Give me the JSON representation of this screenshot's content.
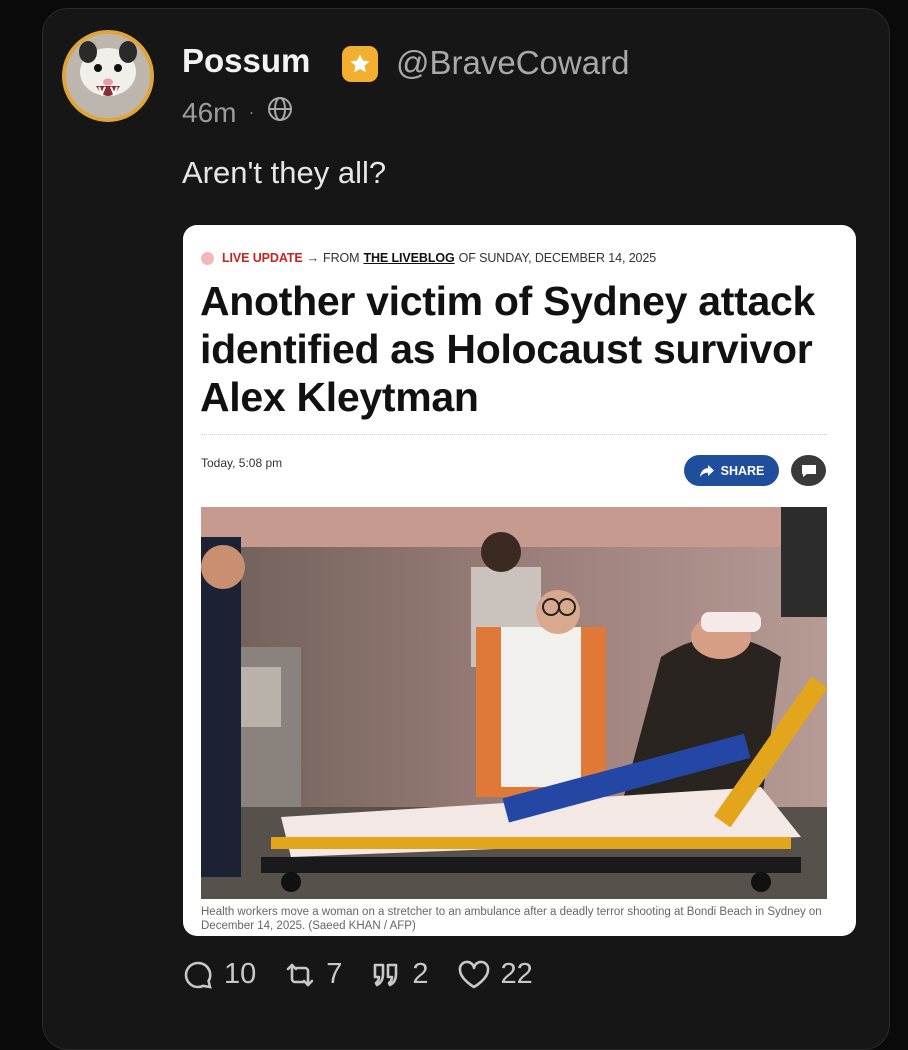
{
  "post": {
    "display_name": "Possum",
    "handle": "@BraveCoward",
    "time_ago": "46m",
    "separator": "·",
    "text": "Aren't they all?"
  },
  "article": {
    "live_label": "LIVE UPDATE",
    "arrow": "→",
    "from_text": "FROM",
    "liveblog_text": "THE LIVEBLOG",
    "date_text": "OF SUNDAY, DECEMBER 14, 2025",
    "headline": "Another victim of Sydney attack identified as Holocaust survivor Alex Kleytman",
    "time": "Today, 5:08 pm",
    "share_label": "SHARE",
    "caption": "Health workers move a woman on a stretcher to an ambulance after a deadly terror shooting at Bondi Beach in Sydney on December 14, 2025. (Saeed KHAN / AFP)"
  },
  "actions": {
    "replies": "10",
    "reposts": "7",
    "quotes": "2",
    "likes": "22"
  },
  "colors": {
    "verified_badge": "#f2b030",
    "avatar_ring": "#e0a53a",
    "live_red": "#c8241f",
    "share_blue": "#1f4f9c"
  },
  "icons": [
    "globe-icon",
    "star-icon",
    "share-arrow-icon",
    "comment-icon",
    "reply-icon",
    "repost-icon",
    "quote-icon",
    "like-icon"
  ]
}
